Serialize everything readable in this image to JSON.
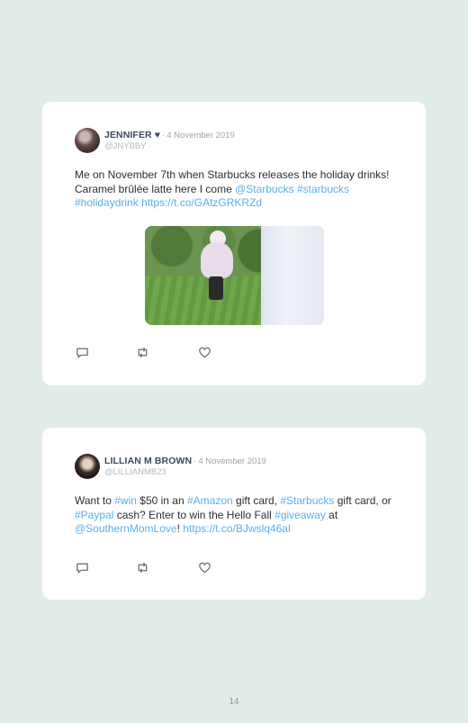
{
  "page_number": "14",
  "colors": {
    "background": "#e1ece6",
    "card": "#ffffff",
    "name": "#3c4a5a",
    "link": "#5ab0e8",
    "muted": "#9aa4ae"
  },
  "tweets": [
    {
      "name": "JENNIFER ♥",
      "date": "4 November 2019",
      "handle": "@JNYBBY",
      "text_parts": [
        {
          "text": "Me on November 7th when Starbucks releases the holiday drinks! Caramel brûlée latte here I come ",
          "link": false
        },
        {
          "text": "@Starbucks",
          "link": true
        },
        {
          "text": " ",
          "link": false
        },
        {
          "text": "#starbucks",
          "link": true
        },
        {
          "text": " ",
          "link": false
        },
        {
          "text": "#holidaydrink",
          "link": true
        },
        {
          "text": " ",
          "link": false
        },
        {
          "text": "https://t.co/GAtzGRKRZd",
          "link": true
        }
      ],
      "has_media": true,
      "actions": [
        "reply-icon",
        "retweet-icon",
        "like-icon"
      ]
    },
    {
      "name": "LILLIAN M BROWN",
      "date": "4 November 2019",
      "handle": "@LILLIANMB23",
      "text_parts": [
        {
          "text": "Want to ",
          "link": false
        },
        {
          "text": "#win",
          "link": true
        },
        {
          "text": " $50 in an ",
          "link": false
        },
        {
          "text": "#Amazon",
          "link": true
        },
        {
          "text": " gift card, ",
          "link": false
        },
        {
          "text": "#Starbucks",
          "link": true
        },
        {
          "text": " gift card, or ",
          "link": false
        },
        {
          "text": "#Paypal",
          "link": true
        },
        {
          "text": " cash? Enter to win the Hello Fall ",
          "link": false
        },
        {
          "text": "#giveaway",
          "link": true
        },
        {
          "text": " at ",
          "link": false
        },
        {
          "text": "@SouthernMomLove",
          "link": true
        },
        {
          "text": "! ",
          "link": false
        },
        {
          "text": "https://t.co/BJwslq46al",
          "link": true
        }
      ],
      "has_media": false,
      "actions": [
        "reply-icon",
        "retweet-icon",
        "like-icon"
      ]
    }
  ]
}
